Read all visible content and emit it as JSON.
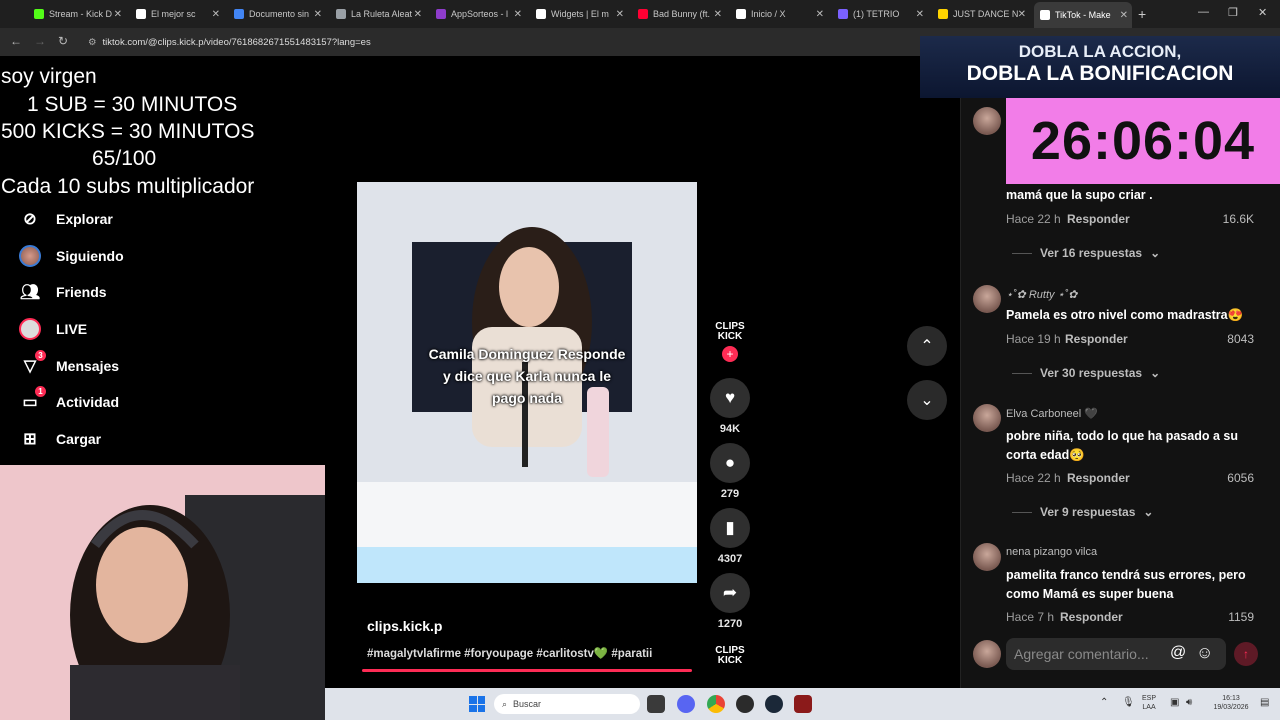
{
  "browser": {
    "tabs": [
      {
        "label": "Stream - Kick D",
        "color": "#53fc18"
      },
      {
        "label": "El mejor sc",
        "color": "#ffffff"
      },
      {
        "label": "Documento sin",
        "color": "#4285f4"
      },
      {
        "label": "La Ruleta Aleat",
        "color": "#9aa0a6"
      },
      {
        "label": "AppSorteos - l",
        "color": "#8e3ccb"
      },
      {
        "label": "Widgets | El m",
        "color": "#ffffff"
      },
      {
        "label": "Bad Bunny (ft.",
        "color": "#ff0033"
      },
      {
        "label": "Inicio / X",
        "color": "#ffffff"
      },
      {
        "label": "(1) TETRIO",
        "color": "#7b61ff"
      },
      {
        "label": "JUST DANCE N",
        "color": "#ffd400"
      },
      {
        "label": "TikTok - Make",
        "color": "#ffffff"
      }
    ],
    "url": "tiktok.com/@clips.kick.p/video/7618682671551483157?lang=es"
  },
  "overlay": {
    "lines": [
      "soy virgen",
      "1 SUB      = 30 MINUTOS",
      "500 KICKS = 30 MINUTOS",
      "65/100",
      "Cada 10 subs multiplicador"
    ]
  },
  "sidebar": {
    "items": [
      {
        "label": "Explorar",
        "icon": "compass-icon"
      },
      {
        "label": "Siguiendo",
        "icon": "avatar-icon"
      },
      {
        "label": "Friends",
        "icon": "friends-icon"
      },
      {
        "label": "LIVE",
        "icon": "live-icon"
      },
      {
        "label": "Mensajes",
        "icon": "messages-icon",
        "badge": "3"
      },
      {
        "label": "Actividad",
        "icon": "activity-icon",
        "badge": "1"
      },
      {
        "label": "Cargar",
        "icon": "upload-icon"
      }
    ]
  },
  "video": {
    "caption": [
      "Camila Dominguez Responde",
      "y dice que Karla nunca le",
      "pago nada"
    ],
    "author": "clips.kick.p",
    "hashtags": "#magalytvlafirme #foryoupage #carlitostv💚 #paratii",
    "brand": "CLIPS KICK",
    "likes": "94K",
    "comments": "279",
    "saves": "4307",
    "shares": "1270"
  },
  "banner": {
    "line1": "DOBLA LA ACCION,",
    "line2": "DOBLA LA BONIFICACION"
  },
  "timer": "26:06:04",
  "comments_panel": {
    "items": [
      {
        "name": "",
        "text": "mamá que la supo criar .",
        "time": "Hace 22 h",
        "reply": "Responder",
        "likes": "16.6K",
        "more": "Ver 16 respuestas"
      },
      {
        "name": "⋆˚✿ Rutty ⋆˚✿",
        "text": "Pamela es otro nivel como madrastra😍",
        "time": "Hace 19 h",
        "reply": "Responder",
        "likes": "8043",
        "more": "Ver 30 respuestas"
      },
      {
        "name": "Elva Carboneel 🖤",
        "text": "pobre niña, todo lo que ha pasado a su corta edad🥺",
        "time": "Hace 22 h",
        "reply": "Responder",
        "likes": "6056",
        "more": "Ver 9 respuestas"
      },
      {
        "name": "nena pizango vilca",
        "text": "pamelita franco tendrá sus errores, pero como Mamá es super buena",
        "time": "Hace 7 h",
        "reply": "Responder",
        "likes": "1159",
        "more": ""
      }
    ],
    "input_placeholder": "Agregar comentario..."
  },
  "taskbar": {
    "search_placeholder": "Buscar",
    "lang": "ESP",
    "lang2": "LAA",
    "time": "16:13",
    "date": "19/03/2026"
  }
}
